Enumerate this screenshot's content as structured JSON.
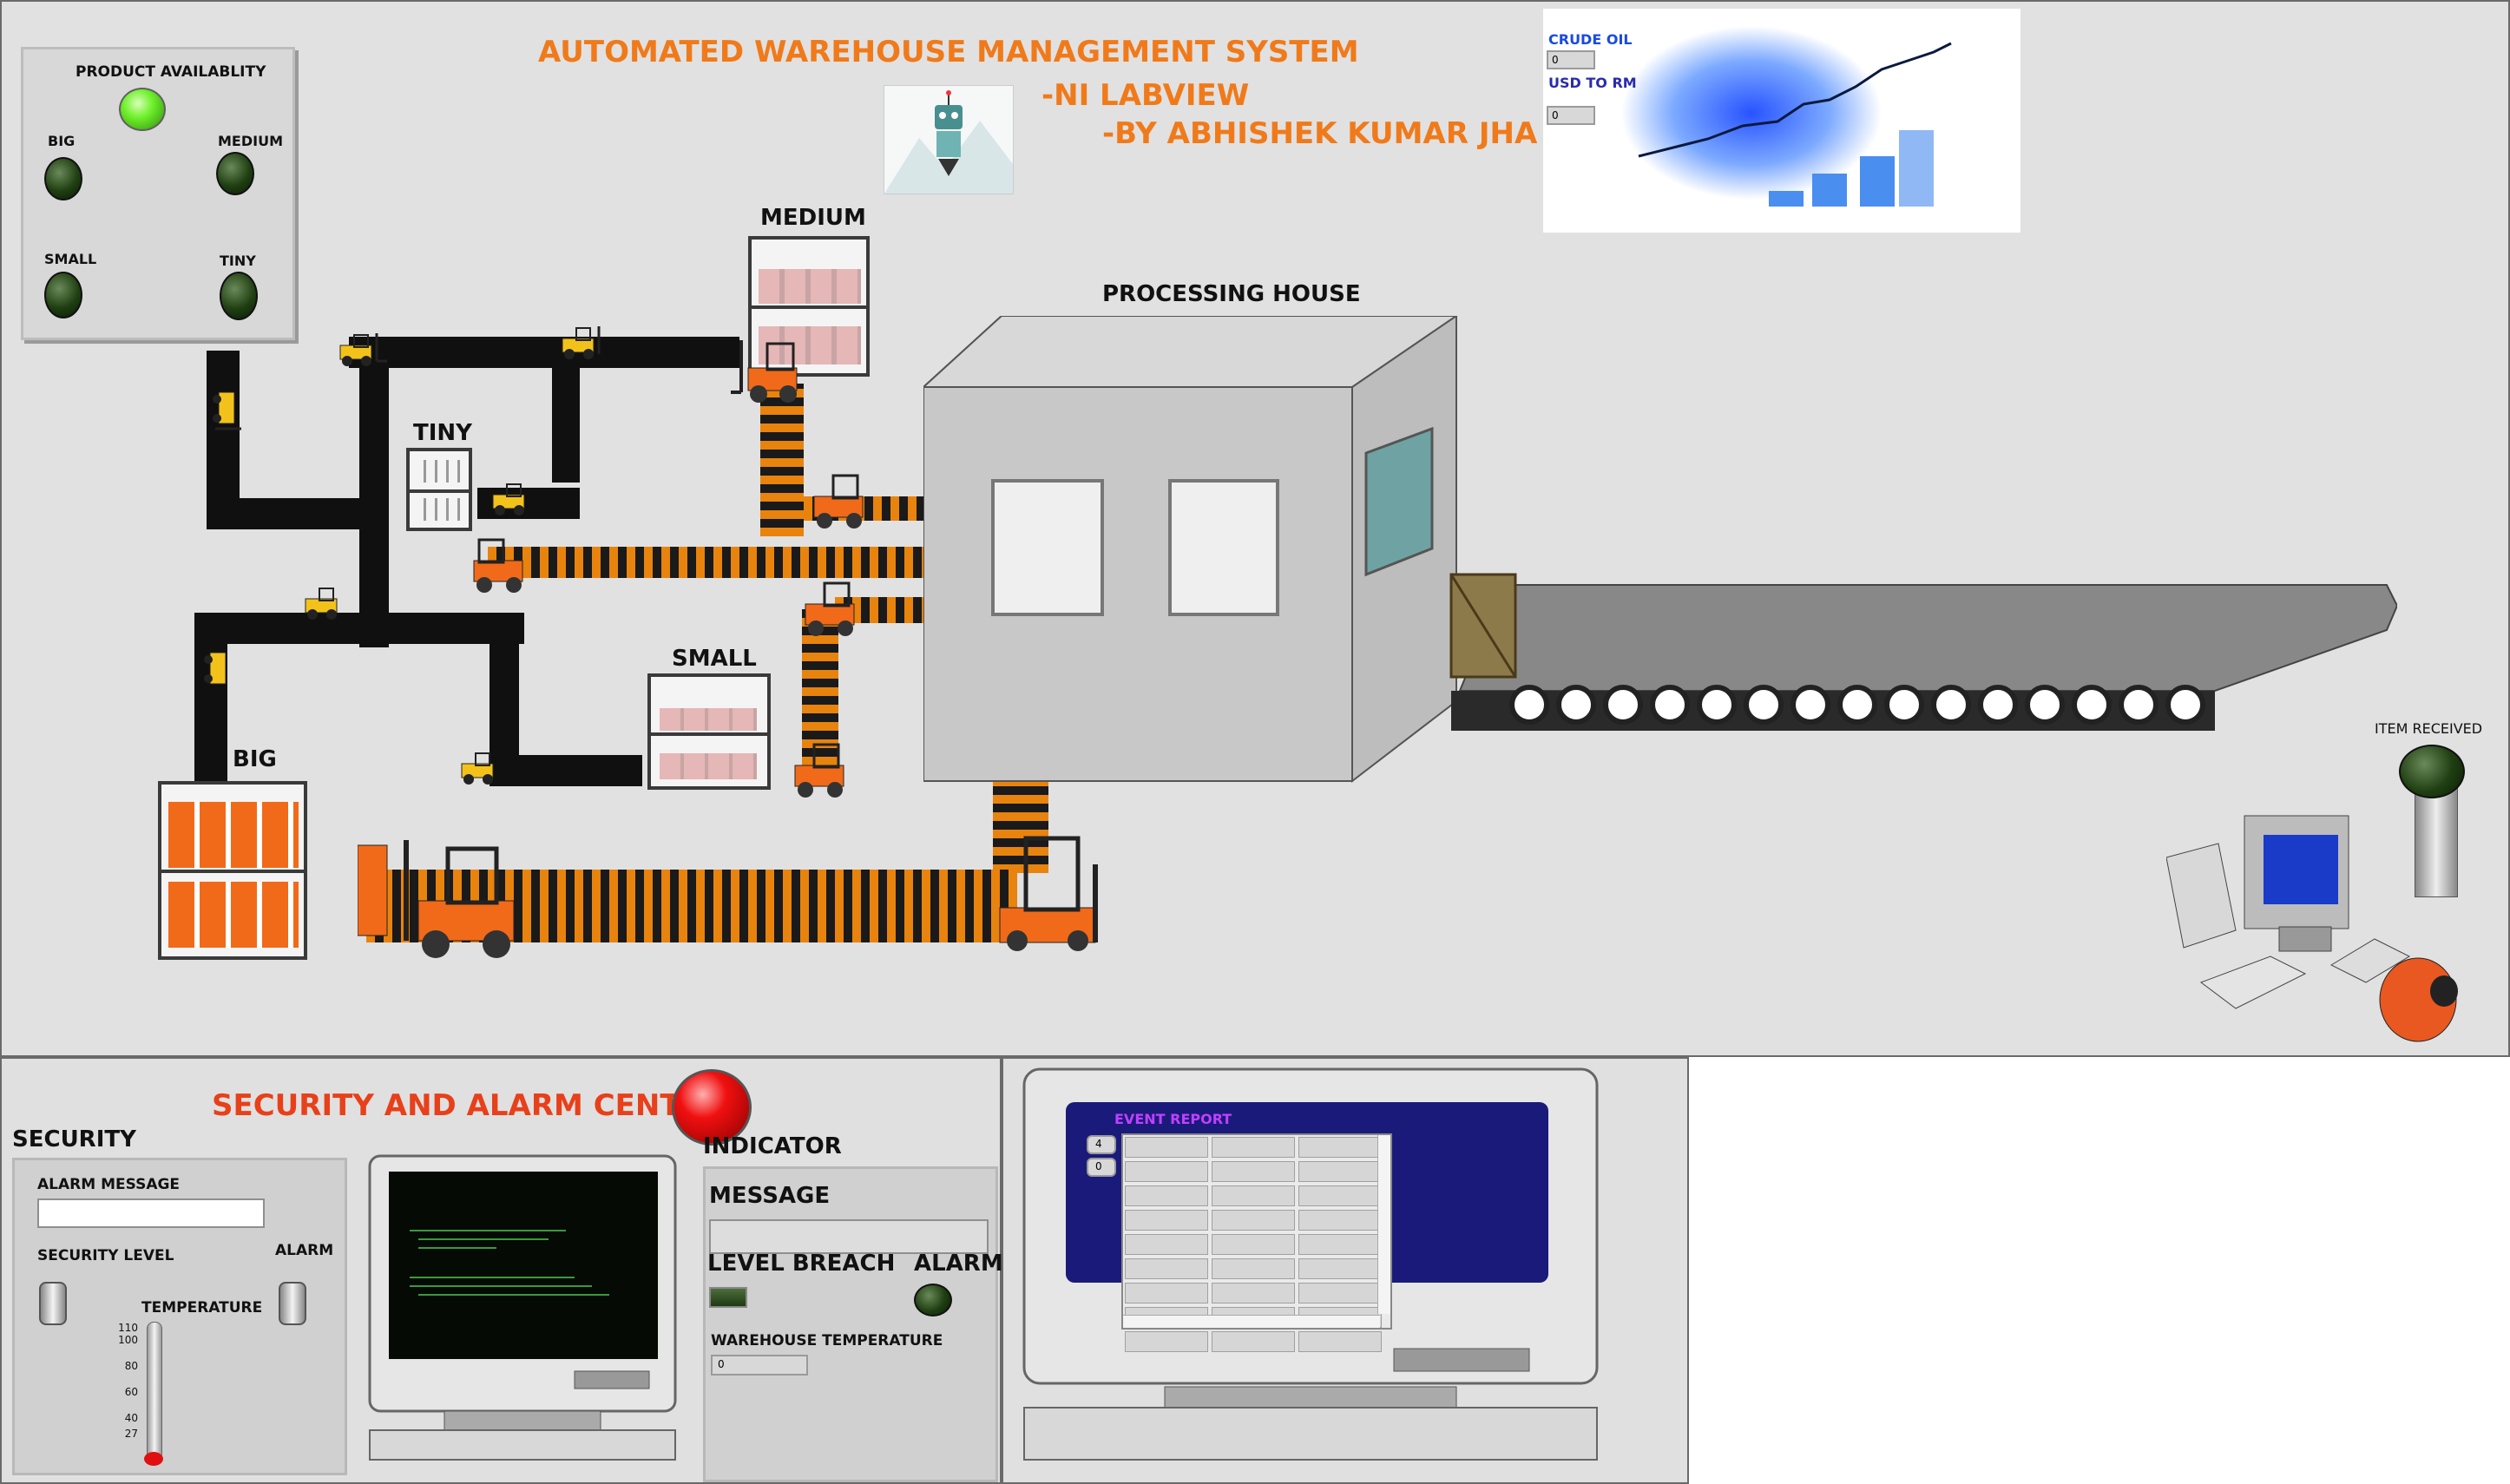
{
  "header": {
    "title": "AUTOMATED WAREHOUSE MANAGEMENT SYSTEM",
    "subtitle1": "-NI LABVIEW",
    "subtitle2": "-BY ABHISHEK KUMAR JHA"
  },
  "availability": {
    "title": "PRODUCT AVAILABLITY",
    "master_on": true,
    "items": [
      {
        "label": "BIG",
        "on": false
      },
      {
        "label": "MEDIUM",
        "on": false
      },
      {
        "label": "SMALL",
        "on": false
      },
      {
        "label": "TINY",
        "on": false
      }
    ]
  },
  "market": {
    "crude_label": "CRUDE OIL",
    "crude_value": "0",
    "usd_label": "USD TO RM",
    "usd_value": "0"
  },
  "warehouse": {
    "medium": "MEDIUM",
    "tiny": "TINY",
    "small": "SMALL",
    "big": "BIG",
    "processing_house": "PROCESSING HOUSE",
    "item_received": "ITEM RECEIVED",
    "item_received_on": false
  },
  "security_center": {
    "title": "SECURITY AND ALARM CENTER",
    "security_heading": "SECURITY",
    "alarm_message_label": "ALARM MESSAGE",
    "alarm_message_value": "",
    "security_level_label": "SECURITY LEVEL",
    "alarm_label": "ALARM",
    "temperature_label": "TEMPERATURE",
    "temperature_ticks": [
      "110",
      "100",
      "80",
      "60",
      "40",
      "27"
    ],
    "temperature_value": 27,
    "indicator_heading": "INDICATOR",
    "message_label": "MESSAGE",
    "message_value": "",
    "level_breach_label": "LEVEL BREACH",
    "alarm_indicator_label": "ALARM",
    "warehouse_temp_label": "WAREHOUSE TEMPERATURE",
    "warehouse_temp_value": "0"
  },
  "event_report": {
    "title": "EVENT REPORT",
    "row_index": "4",
    "col_index": "0",
    "rows": 9,
    "cols": 3
  },
  "colors": {
    "title_orange": "#f07a1a",
    "alarm_red": "#e8401a",
    "conveyor_black": "#101010",
    "stripe_orange": "#e8830e",
    "event_blue": "#1a1a7a",
    "event_title": "#c040ff"
  }
}
